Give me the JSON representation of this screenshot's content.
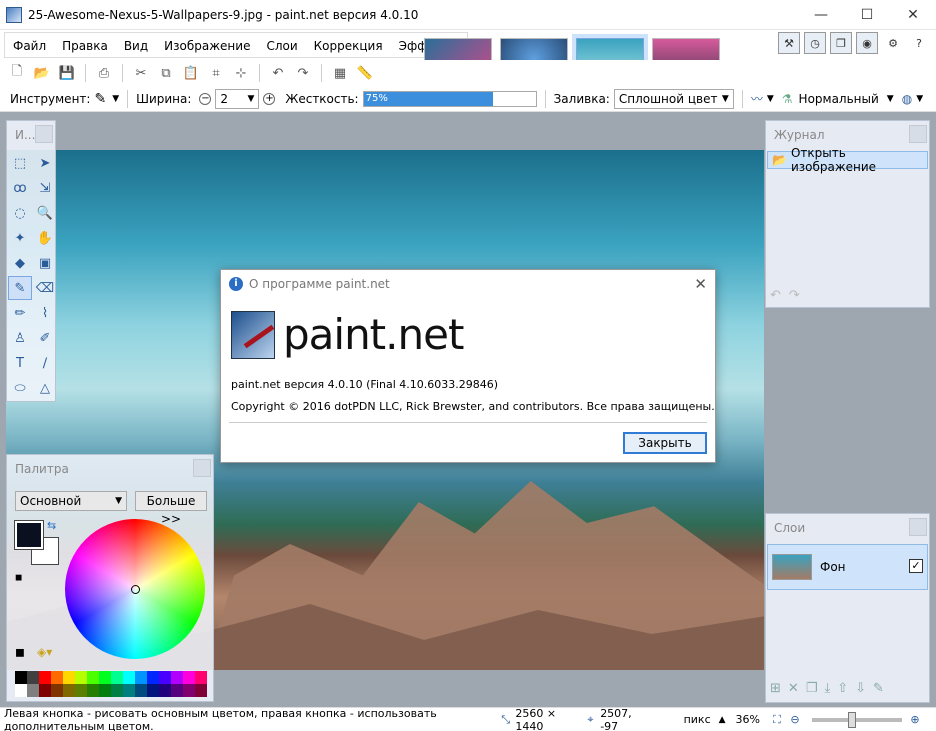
{
  "window": {
    "title": "25-Awesome-Nexus-5-Wallpapers-9.jpg - paint.net версия 4.0.10",
    "minimize": "—",
    "maximize": "☐",
    "close": "✕"
  },
  "menu": [
    "Файл",
    "Правка",
    "Вид",
    "Изображение",
    "Слои",
    "Коррекция",
    "Эффекты"
  ],
  "thumbnails": [
    "#c84a8a",
    "#2a4f7a",
    "#6bbfd0",
    "#d65a9c"
  ],
  "options": {
    "tool_label": "Инструмент:",
    "width_label": "Ширина:",
    "width_value": "2",
    "hardness_label": "Жесткость:",
    "hardness_value": "75%",
    "hardness_fraction": 0.75,
    "fill_label": "Заливка:",
    "fill_value": "Сплошной цвет",
    "blend_value": "Нормальный"
  },
  "panels": {
    "tools_title": "И...",
    "history_title": "Журнал",
    "history_items": [
      "Открыть изображение"
    ],
    "palette_title": "Палитра",
    "palette_mode": "Основной",
    "palette_more": "Больше >>",
    "layers_title": "Слои",
    "layers": [
      "Фон"
    ]
  },
  "colors": {
    "primary": "#0b1020",
    "secondary": "#ffffff",
    "accent": "#3c8fdc",
    "swatches": [
      "#000000",
      "#404040",
      "#ff0000",
      "#ff6a00",
      "#ffd800",
      "#b6ff00",
      "#4cff00",
      "#00ff21",
      "#00ff90",
      "#00ffff",
      "#0094ff",
      "#0026ff",
      "#4800ff",
      "#b200ff",
      "#ff00dc",
      "#ff006e",
      "#ffffff",
      "#808080",
      "#7f0000",
      "#7f3300",
      "#7f6a00",
      "#5b7f00",
      "#267f00",
      "#007f0e",
      "#007f46",
      "#007f7f",
      "#004a7f",
      "#00137f",
      "#21007f",
      "#57007f",
      "#7f006e",
      "#7f0037"
    ]
  },
  "dialog": {
    "title": "О программе paint.net",
    "logo_text": "paint.net",
    "version_line": "paint.net версия 4.0.10 (Final 4.10.6033.29846)",
    "copyright_line": "Copyright © 2016 dotPDN LLC, Rick Brewster, and contributors. Все права защищены.",
    "close_button": "Закрыть"
  },
  "status": {
    "hint": "Левая кнопка - рисовать основным цветом, правая кнопка - использовать дополнительным цветом.",
    "image_size": "2560 × 1440",
    "cursor_pos": "2507, -97",
    "units": "пикс",
    "zoom": "36%"
  }
}
